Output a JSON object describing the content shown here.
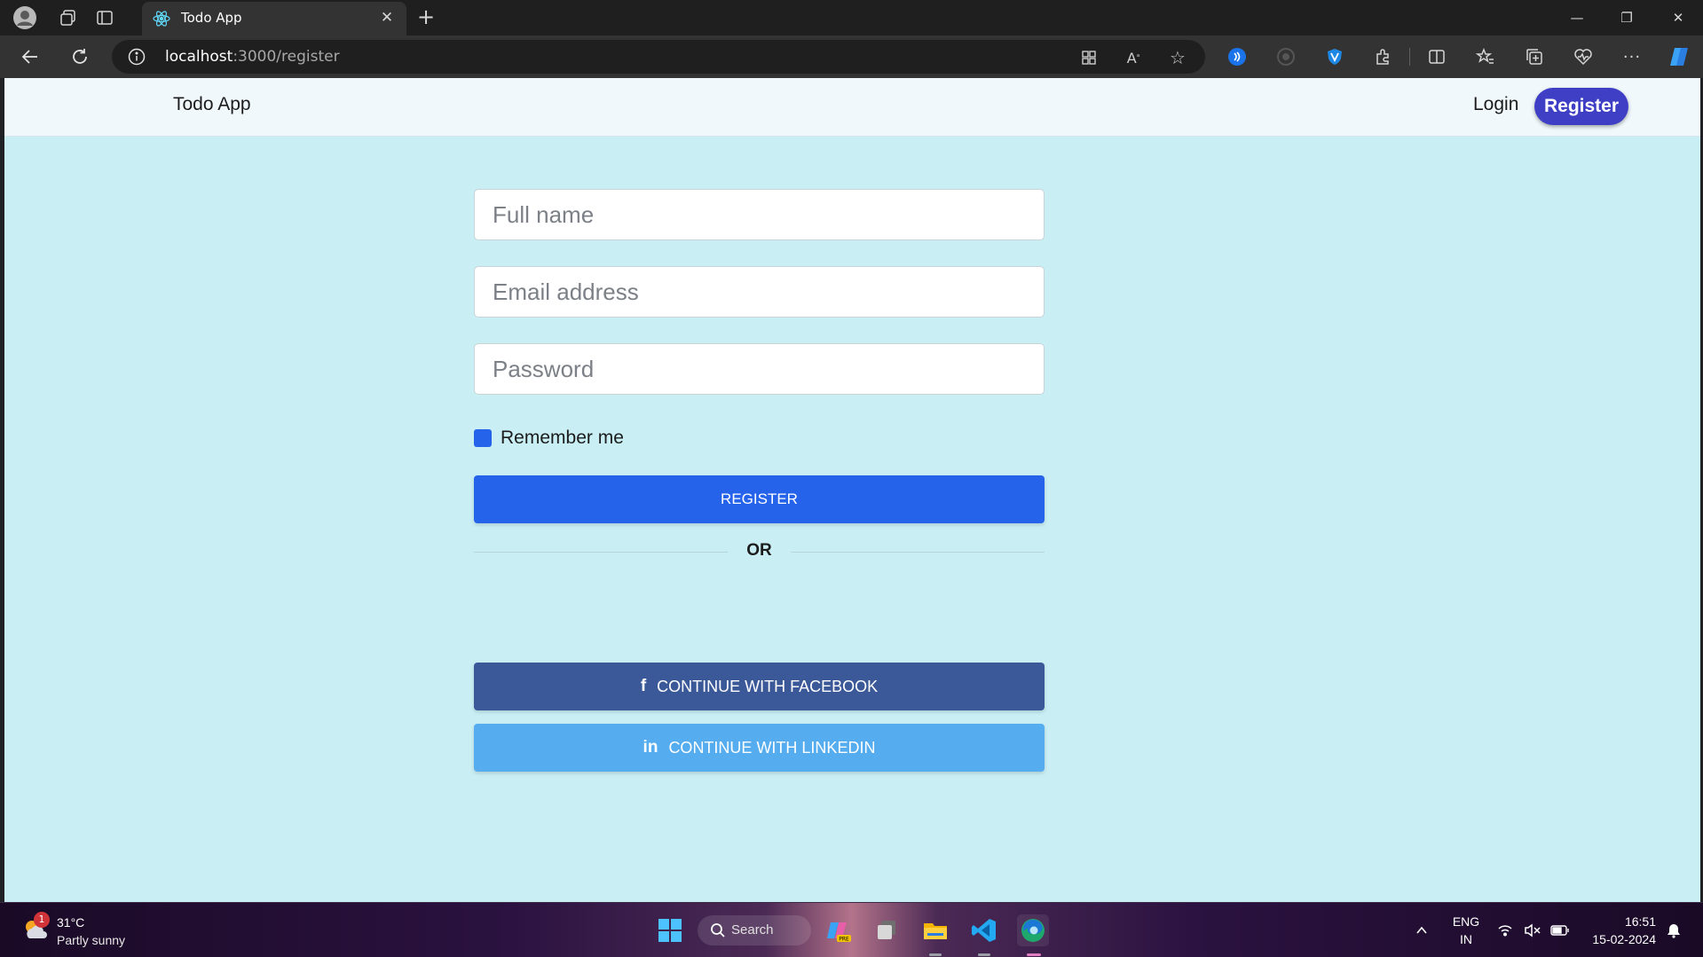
{
  "browser": {
    "tab_title": "Todo App",
    "url_host": "localhost",
    "url_path": ":3000/register"
  },
  "app": {
    "brand": "Todo App",
    "nav_login": "Login",
    "nav_register": "Register"
  },
  "form": {
    "fullname_placeholder": "Full name",
    "email_placeholder": "Email address",
    "password_placeholder": "Password",
    "remember_label": "Remember me",
    "remember_checked": true,
    "register_button": "REGISTER",
    "or_divider": "OR",
    "facebook_button": "CONTINUE WITH FACEBOOK",
    "linkedin_button": "CONTINUE WITH LINKEDIN"
  },
  "taskbar": {
    "weather_temp": "31°C",
    "weather_desc": "Partly sunny",
    "weather_badge": "1",
    "search_label": "Search",
    "lang_top": "ENG",
    "lang_bottom": "IN",
    "time": "16:51",
    "date": "15-02-2024"
  },
  "colors": {
    "page_bg": "#c9eff5",
    "header_bg": "#f0f8fc",
    "primary": "#2563eb",
    "nav_register_bg": "#3f3fc6",
    "facebook": "#3b5998",
    "linkedin": "#55acee"
  }
}
